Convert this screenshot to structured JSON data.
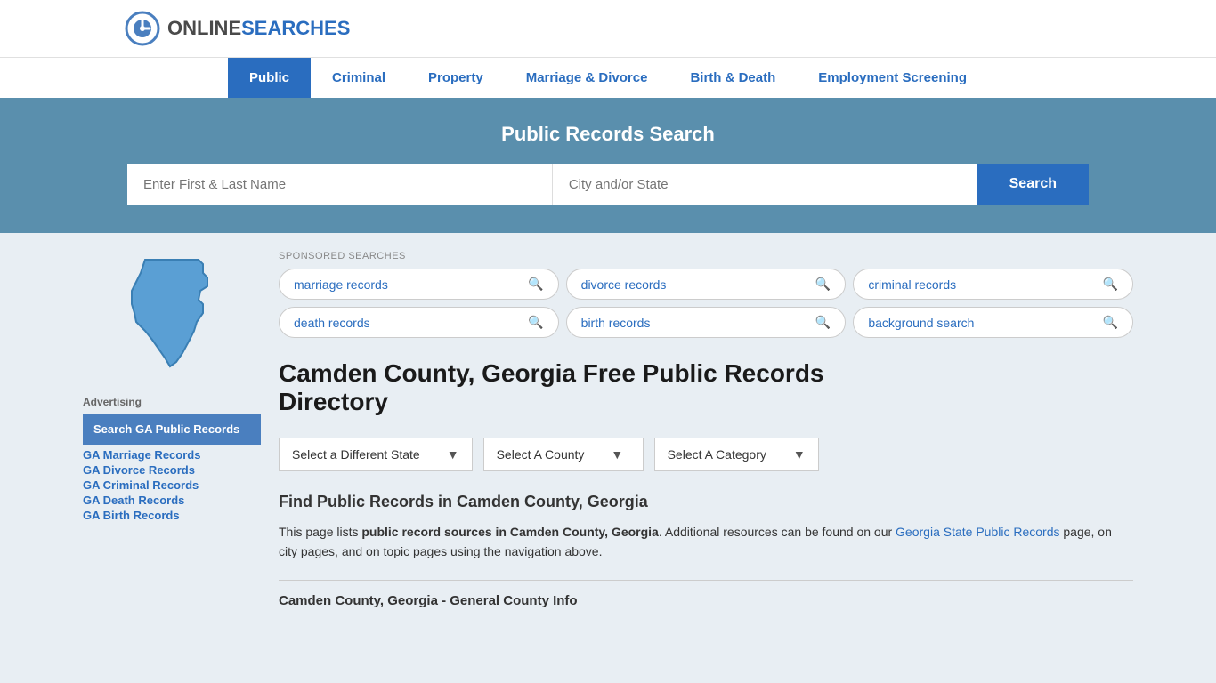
{
  "logo": {
    "online": "ONLINE",
    "searches": "SEARCHES"
  },
  "nav": {
    "items": [
      {
        "label": "Public",
        "active": true
      },
      {
        "label": "Criminal",
        "active": false
      },
      {
        "label": "Property",
        "active": false
      },
      {
        "label": "Marriage & Divorce",
        "active": false
      },
      {
        "label": "Birth & Death",
        "active": false
      },
      {
        "label": "Employment Screening",
        "active": false
      }
    ]
  },
  "hero": {
    "title": "Public Records Search",
    "name_placeholder": "Enter First & Last Name",
    "location_placeholder": "City and/or State",
    "search_button": "Search"
  },
  "sponsored": {
    "label": "SPONSORED SEARCHES",
    "tags": [
      {
        "label": "marriage records"
      },
      {
        "label": "divorce records"
      },
      {
        "label": "criminal records"
      },
      {
        "label": "death records"
      },
      {
        "label": "birth records"
      },
      {
        "label": "background search"
      }
    ]
  },
  "page": {
    "title_line1": "Camden County, Georgia Free Public Records",
    "title_line2": "Directory"
  },
  "dropdowns": {
    "state": "Select a Different State",
    "county": "Select A County",
    "category": "Select A Category"
  },
  "find_section": {
    "heading": "Find Public Records in Camden County, Georgia",
    "text_start": "This page lists ",
    "text_bold": "public record sources in Camden County, Georgia",
    "text_middle": ". Additional resources can be found on our ",
    "link_text": "Georgia State Public Records",
    "text_end": " page, on city pages, and on topic pages using the navigation above."
  },
  "county_info": {
    "heading": "Camden County, Georgia - General County Info"
  },
  "sidebar": {
    "advertising_label": "Advertising",
    "ad_box_text": "Search GA Public Records",
    "links": [
      "GA Marriage Records",
      "GA Divorce Records",
      "GA Criminal Records",
      "GA Death Records",
      "GA Birth Records"
    ]
  }
}
